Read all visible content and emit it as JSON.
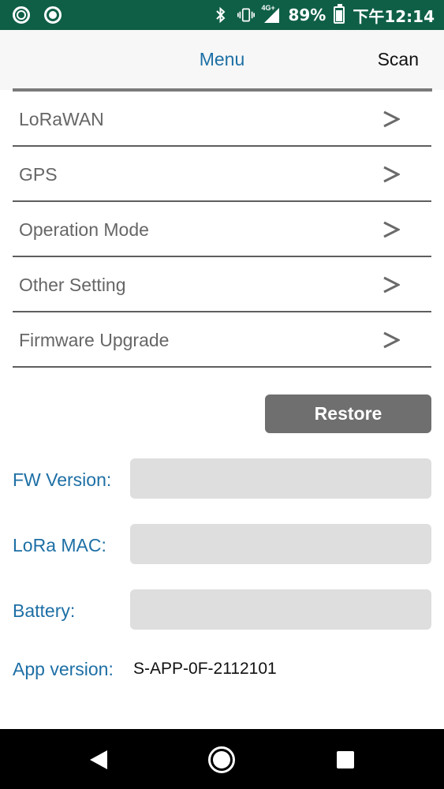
{
  "status_bar": {
    "battery_percent_label": "89%",
    "time": "下午12:14",
    "network_badge": "4G+",
    "icons": [
      "app-notification-icon",
      "app-notification-icon",
      "bluetooth-icon",
      "vibrate-icon",
      "signal-icon",
      "battery-charging-icon"
    ]
  },
  "header": {
    "title": "Menu",
    "scan_label": "Scan"
  },
  "menu": {
    "items": [
      {
        "label": "LoRaWAN",
        "icon": "chevron-right-icon"
      },
      {
        "label": "GPS",
        "icon": "chevron-right-icon"
      },
      {
        "label": "Operation Mode",
        "icon": "chevron-right-icon"
      },
      {
        "label": "Other Setting",
        "icon": "chevron-right-icon"
      },
      {
        "label": "Firmware Upgrade",
        "icon": "chevron-right-icon"
      }
    ]
  },
  "restore_label": "Restore",
  "info": {
    "fw_version_label": "FW Version:",
    "fw_version_value": "",
    "lora_mac_label": "LoRa MAC:",
    "lora_mac_value": "",
    "battery_label": "Battery:",
    "battery_value": "",
    "app_version_label": "App version:",
    "app_version_value": "S-APP-0F-2112101"
  },
  "colors": {
    "status_bar": "#0f5f47",
    "accent": "#1d6fa5",
    "restore_button": "#6f6f6f",
    "field_bg": "#dedede"
  }
}
